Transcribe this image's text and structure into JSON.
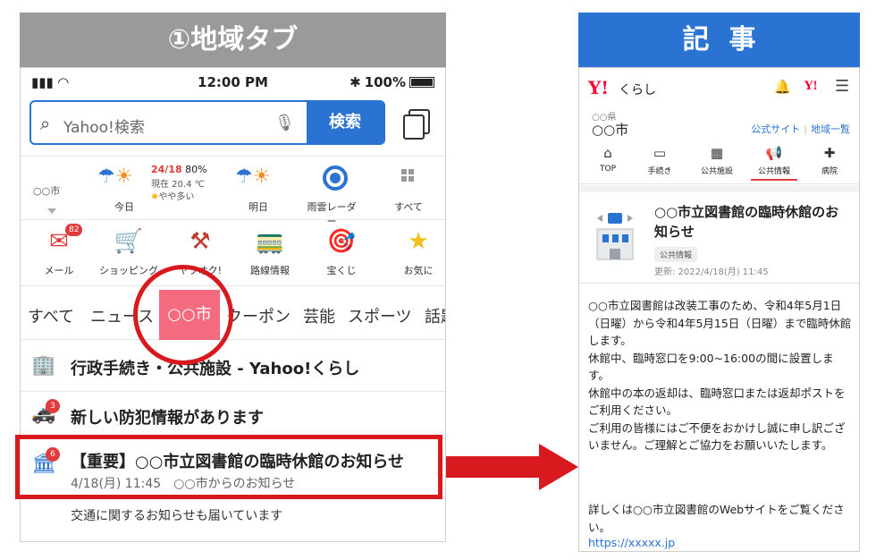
{
  "left_panel": {
    "header": "①地域タブ",
    "status": {
      "time": "12:00 PM",
      "battery": "100%"
    },
    "search": {
      "placeholder": "Yahoo!検索",
      "button": "検索"
    },
    "weather": {
      "city": "○○市",
      "today_label": "今日",
      "temp": "24/18",
      "precip": "80%",
      "now": "現在 20.4 ℃",
      "feel": "やや多い",
      "tomorrow_label": "明日",
      "radar_label": "雨雲レーダー",
      "all_label": "すべて"
    },
    "services": [
      {
        "label": "メール",
        "badge": "82"
      },
      {
        "label": "ショッピング"
      },
      {
        "label": "ヤフオク!"
      },
      {
        "label": "路線情報"
      },
      {
        "label": "宝くじ"
      },
      {
        "label": "お気に"
      }
    ],
    "categories": [
      "すべて",
      "ニュース",
      "○○市",
      "クーポン",
      "芸能",
      "スポーツ",
      "話題"
    ],
    "list": [
      {
        "title": "行政手続き・公共施設 - Yahoo!くらし"
      },
      {
        "title": "新しい防犯情報があります",
        "badge": "3"
      },
      {
        "title": "【重要】○○市立図書館の臨時休館のお知らせ",
        "sub": "4/18(月) 11:45　○○市からのお知らせ",
        "badge": "6"
      }
    ],
    "tail": "交通に関するお知らせも届いています"
  },
  "right_panel": {
    "header": "記事",
    "logo": "Y!",
    "logo_sub": "くらし",
    "small_logo": "Y!",
    "pref": "○○県",
    "city": "○○市",
    "links": [
      "公式サイト",
      "地域一覧"
    ],
    "nav": [
      "TOP",
      "手続き",
      "公共施設",
      "公共情報",
      "病院"
    ],
    "article": {
      "title": "○○市立図書館の臨時休館のお知らせ",
      "tag": "公共情報",
      "date": "更新: 2022/4/18(月) 11:45",
      "body": "○○市立図書館は改装工事のため、令和4年5月1日（日曜）から令和4年5月15日（日曜）まで臨時休館します。\n休館中、臨時窓口を9:00~16:00の間に設置します。\n休館中の本の返却は、臨時窓口または返却ポストをご利用ください。\nご利用の皆様にはご不便をおかけし誠に申し訳ございません。ご理解とご協力をお願いいたします。",
      "more": "詳しくは○○市立図書館のWebサイトをご覧ください。",
      "url": "https://xxxxx.jp"
    }
  },
  "colors": {
    "accent_blue": "#2a73d3",
    "highlight_red": "#d8191d",
    "tab_pink": "#f46a7e",
    "gray_header": "#9a9a9a"
  }
}
